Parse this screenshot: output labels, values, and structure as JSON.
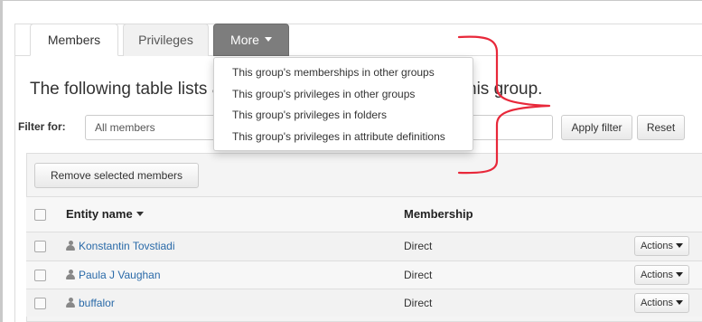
{
  "tabs": {
    "members": "Members",
    "privileges": "Privileges",
    "more": "More"
  },
  "more_menu": {
    "items": [
      {
        "label": "This group's memberships in other groups"
      },
      {
        "label": "This group's privileges in other groups"
      },
      {
        "label": "This group's privileges in folders"
      },
      {
        "label": "This group's privileges in attribute definitions"
      }
    ]
  },
  "intro": {
    "visible_start": "The following table lists a",
    "visible_end": "his group."
  },
  "filter": {
    "label": "Filter for:",
    "value": "All members",
    "apply_label": "Apply filter",
    "reset_label": "Reset"
  },
  "members": {
    "remove_label": "Remove selected members",
    "columns": {
      "entity": "Entity name",
      "membership": "Membership"
    },
    "rows": [
      {
        "name": "Konstantin Tovstiadi",
        "membership": "Direct",
        "actions": "Actions"
      },
      {
        "name": "Paula J Vaughan",
        "membership": "Direct",
        "actions": "Actions"
      },
      {
        "name": "buffalor",
        "membership": "Direct",
        "actions": "Actions"
      }
    ]
  },
  "colors": {
    "more_tab_bg": "#7d7d7d",
    "link": "#2a6aa8",
    "annotation": "#e8283a"
  },
  "icons": {
    "more_caret": "caret-down-icon",
    "sort": "sort-down-icon",
    "person": "person-icon",
    "actions_caret": "caret-down-icon"
  }
}
